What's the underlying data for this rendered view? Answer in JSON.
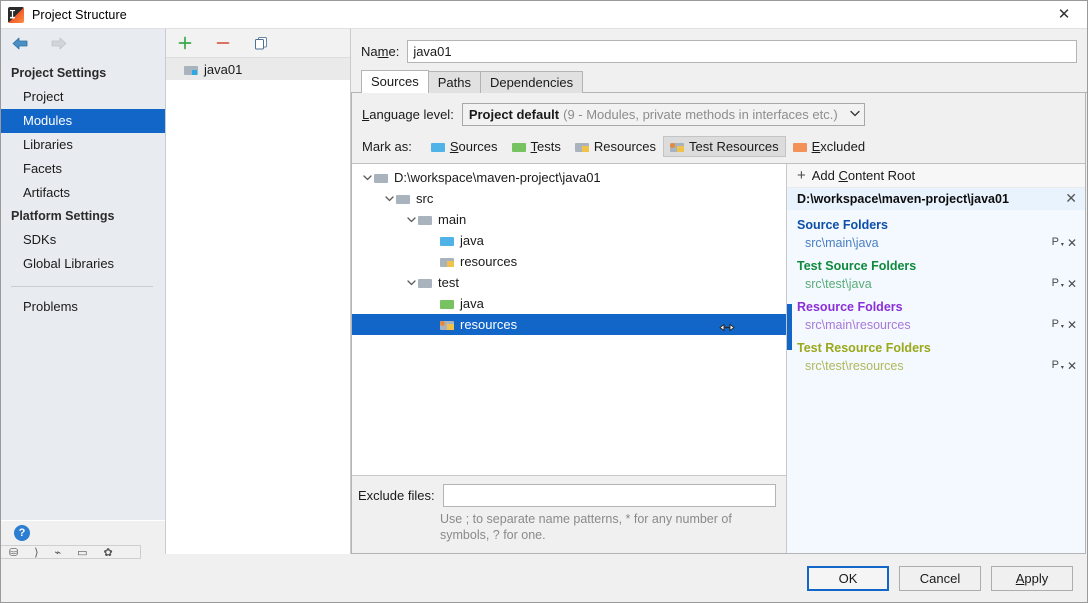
{
  "window": {
    "title": "Project Structure",
    "app_icon": "intellij-idea-icon",
    "close_label": "✕"
  },
  "sidebar": {
    "nav": {
      "back": "←",
      "forward": "→"
    },
    "groups": [
      {
        "label": "Project Settings",
        "items": [
          {
            "label": "Project",
            "selected": false
          },
          {
            "label": "Modules",
            "selected": true
          },
          {
            "label": "Libraries",
            "selected": false
          },
          {
            "label": "Facets",
            "selected": false
          },
          {
            "label": "Artifacts",
            "selected": false
          }
        ]
      },
      {
        "label": "Platform Settings",
        "items": [
          {
            "label": "SDKs",
            "selected": false
          },
          {
            "label": "Global Libraries",
            "selected": false
          }
        ]
      }
    ],
    "problems": "Problems",
    "help_badge": "?"
  },
  "modules_panel": {
    "toolbar": {
      "add": "+",
      "remove": "−",
      "copy": "copy-icon"
    },
    "items": [
      {
        "label": "java01",
        "selected": true
      }
    ]
  },
  "name_field": {
    "label": "Name:",
    "label_mnemonic_before": "Na",
    "label_mnemonic": "m",
    "label_mnemonic_after": "e:",
    "value": "java01",
    "placeholder": ""
  },
  "tabs": [
    {
      "label": "Sources",
      "active": true
    },
    {
      "label": "Paths",
      "active": false
    },
    {
      "label": "Dependencies",
      "active": false
    }
  ],
  "language_level": {
    "label": "Language level:",
    "label_mnemonic_before": "",
    "label_mnemonic": "L",
    "label_mnemonic_after": "anguage level:",
    "value_strong": "Project default",
    "value_dim": "(9 - Modules, private methods in interfaces etc.)",
    "caret": "∨"
  },
  "mark_as": {
    "label": "Mark as:",
    "options": [
      {
        "label": "Sources",
        "mnemonic": "S",
        "rest": "ources",
        "color": "#4fb3e8",
        "badge": "none",
        "active": false
      },
      {
        "label": "Tests",
        "mnemonic": "T",
        "rest": "ests",
        "color": "#77c362",
        "badge": "none",
        "active": false
      },
      {
        "label": "Resources",
        "mnemonic": "",
        "rest": "Resources",
        "color": "#a8b3bd",
        "badge": "#f0c14b",
        "active": false
      },
      {
        "label": "Test Resources",
        "mnemonic": "",
        "rest": "Test Resources",
        "color": "#a8b3bd",
        "badge": "#e8883a",
        "active": true
      },
      {
        "label": "Excluded",
        "mnemonic": "E",
        "rest": "xcluded",
        "color": "#f2915a",
        "badge": "none",
        "active": false
      }
    ]
  },
  "tree": [
    {
      "label": "D:\\workspace\\maven-project\\java01",
      "depth": 0,
      "twist": "⌄",
      "color": "#a8b3bd",
      "badge": "none",
      "selected": false
    },
    {
      "label": "src",
      "depth": 1,
      "twist": "⌄",
      "color": "#a8b3bd",
      "badge": "none",
      "selected": false
    },
    {
      "label": "main",
      "depth": 2,
      "twist": "⌄",
      "color": "#a8b3bd",
      "badge": "none",
      "selected": false
    },
    {
      "label": "java",
      "depth": 3,
      "twist": "",
      "color": "#4fb3e8",
      "badge": "none",
      "selected": false
    },
    {
      "label": "resources",
      "depth": 3,
      "twist": "",
      "color": "#a8b3bd",
      "badge": "#f0c14b",
      "selected": false
    },
    {
      "label": "test",
      "depth": 2,
      "twist": "⌄",
      "color": "#a8b3bd",
      "badge": "none",
      "selected": false
    },
    {
      "label": "java",
      "depth": 3,
      "twist": "",
      "color": "#77c362",
      "badge": "none",
      "selected": false
    },
    {
      "label": "resources",
      "depth": 3,
      "twist": "",
      "color": "#a8b3bd",
      "badge": "#e8883a",
      "selected": true
    }
  ],
  "exclude_files": {
    "label": "Exclude files:",
    "value": "",
    "placeholder": "",
    "hint": "Use ; to separate name patterns, * for any number of symbols, ? for one."
  },
  "details": {
    "add_content_root": "Add Content Root",
    "add_mnemonic_before": "Add ",
    "add_mnemonic": "C",
    "add_mnemonic_after": "ontent Root",
    "plus": "+",
    "root_path": "D:\\workspace\\maven-project\\java01",
    "root_close": "✕",
    "groups": [
      {
        "title": "Source Folders",
        "title_color": "#0d4fa8",
        "path": "src\\main\\java",
        "path_color": "#4a7fc1",
        "prefix_icon": "P",
        "remove_icon": "✕"
      },
      {
        "title": "Test Source Folders",
        "title_color": "#0f8a3c",
        "path": "src\\test\\java",
        "path_color": "#5aac78",
        "prefix_icon": "P",
        "remove_icon": "✕"
      },
      {
        "title": "Resource Folders",
        "title_color": "#8b2fd8",
        "path": "src\\main\\resources",
        "path_color": "#a878d8",
        "prefix_icon": "P",
        "remove_icon": "✕"
      },
      {
        "title": "Test Resource Folders",
        "title_color": "#9aa81a",
        "path": "src\\test\\resources",
        "path_color": "#b0b85a",
        "prefix_icon": "P",
        "remove_icon": "✕"
      }
    ]
  },
  "buttons": {
    "ok": "OK",
    "cancel": "Cancel",
    "apply_mnemonic": "A",
    "apply_rest": "pply",
    "apply": "Apply"
  },
  "colors": {
    "accent": "#1266c8",
    "selection": "#1266c8",
    "dialog_bg": "#f0f0f0",
    "detail_bg": "#f3f9fe"
  }
}
